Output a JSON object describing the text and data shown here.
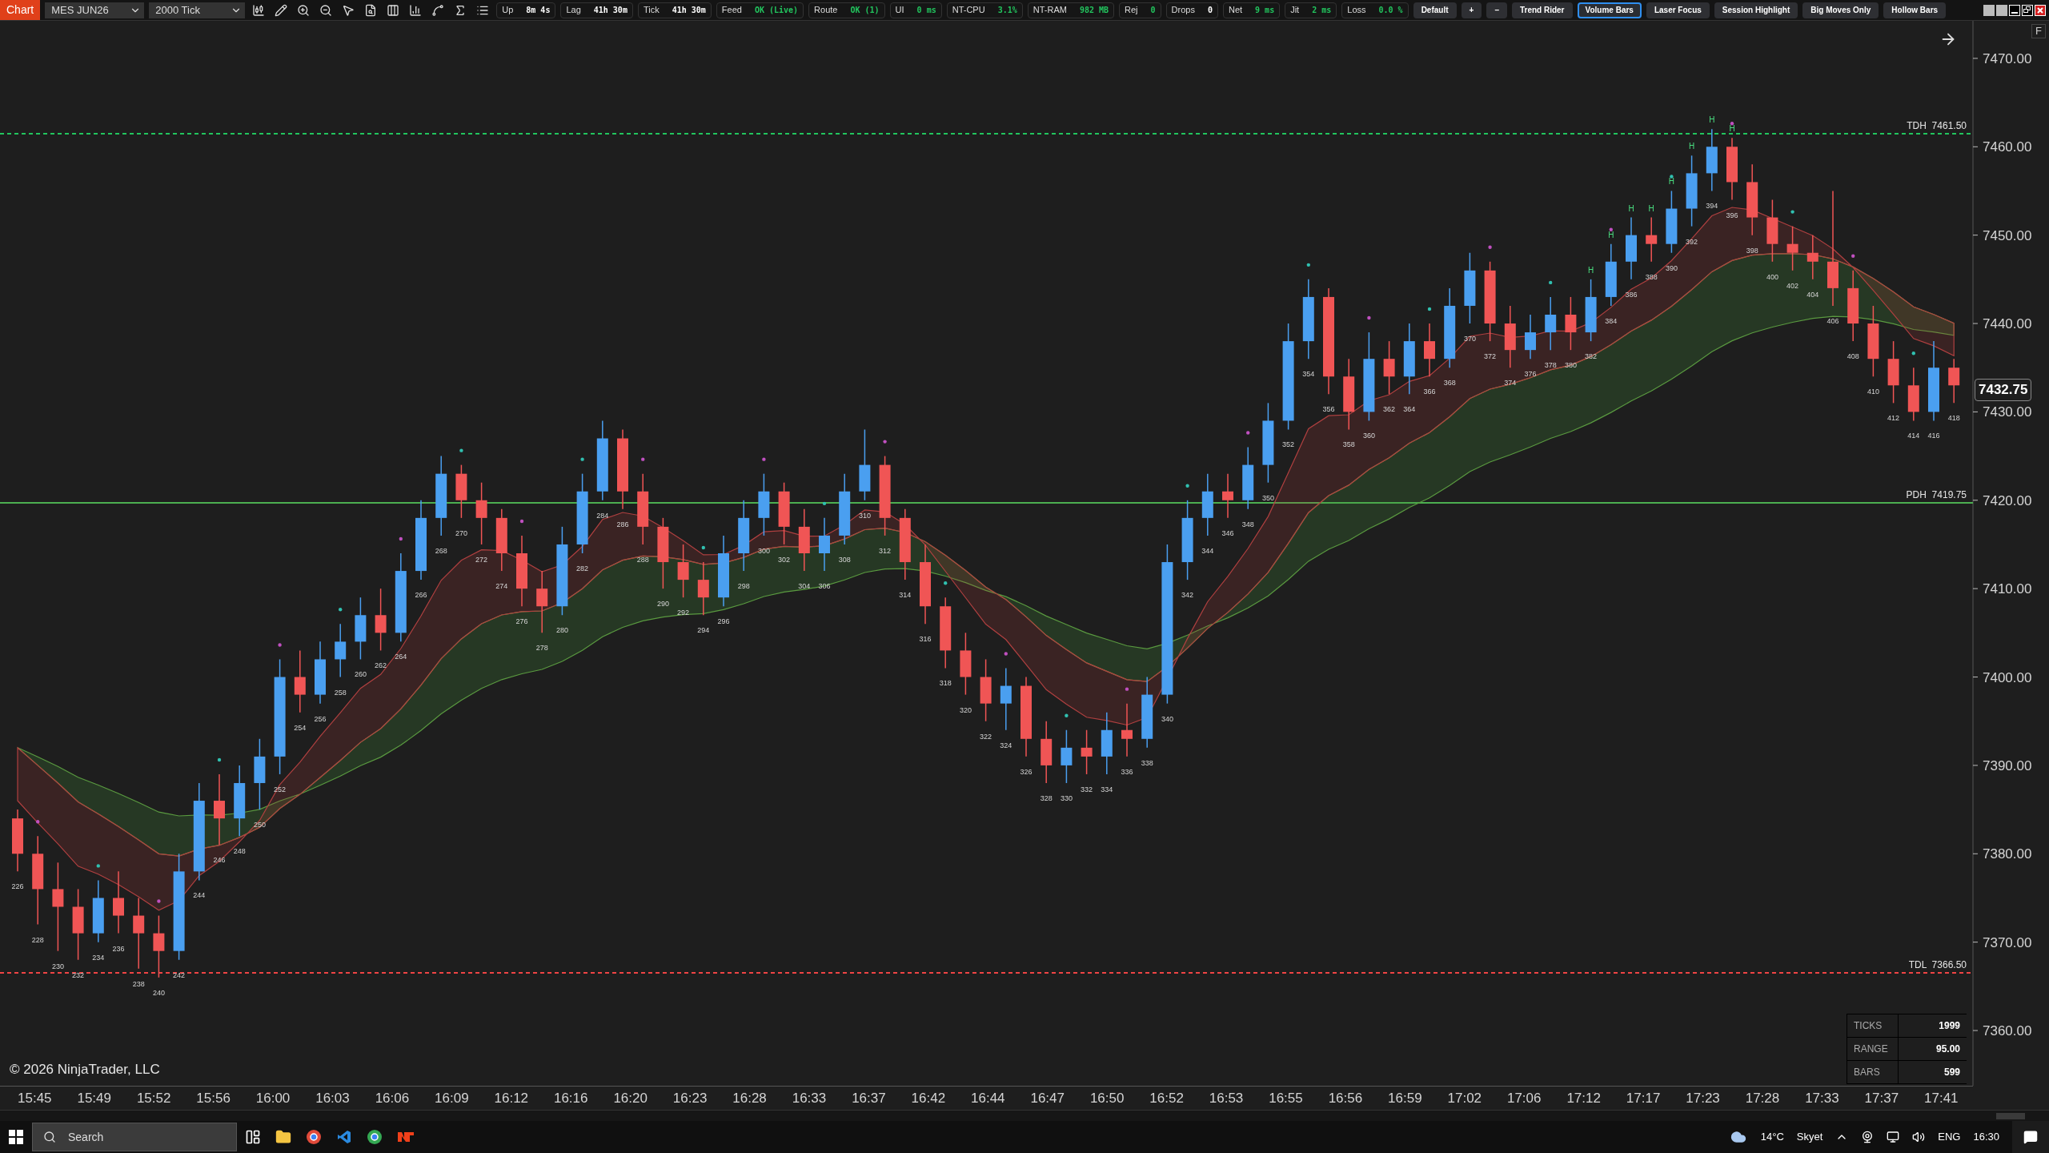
{
  "toolbar": {
    "title": "Chart",
    "instrument": "MES JUN26",
    "interval": "2000 Tick",
    "stats": [
      {
        "label": "Up",
        "value": "8m 4s",
        "color": "#ffffff"
      },
      {
        "label": "Lag",
        "value": "41h 30m",
        "color": "#ffffff"
      },
      {
        "label": "Tick",
        "value": "41h 30m",
        "color": "#ffffff"
      },
      {
        "label": "Feed",
        "value": "OK (Live)",
        "color": "#22c55e"
      },
      {
        "label": "Route",
        "value": "OK (1)",
        "color": "#22c55e"
      },
      {
        "label": "UI",
        "value": "0 ms",
        "color": "#22c55e"
      },
      {
        "label": "NT-CPU",
        "value": "3.1%",
        "color": "#22c55e"
      },
      {
        "label": "NT-RAM",
        "value": "982 MB",
        "color": "#22c55e"
      },
      {
        "label": "Rej",
        "value": "0",
        "color": "#22c55e"
      },
      {
        "label": "Drops",
        "value": "0",
        "color": "#ffffff"
      },
      {
        "label": "Net",
        "value": "9 ms",
        "color": "#22c55e"
      },
      {
        "label": "Jit",
        "value": "2 ms",
        "color": "#22c55e"
      },
      {
        "label": "Loss",
        "value": "0.0 %",
        "color": "#22c55e"
      }
    ],
    "buttons": [
      {
        "label": "Default",
        "selected": false
      },
      {
        "label": "+",
        "selected": false
      },
      {
        "label": "–",
        "selected": false
      },
      {
        "label": "Trend Rider",
        "selected": false
      },
      {
        "label": "Volume Bars",
        "selected": true
      },
      {
        "label": "Laser Focus",
        "selected": false
      },
      {
        "label": "Session Highlight",
        "selected": false
      },
      {
        "label": "Big Moves Only",
        "selected": false
      },
      {
        "label": "Hollow Bars",
        "selected": false
      }
    ]
  },
  "chart": {
    "corner_button": "F",
    "current_price": "7432.75",
    "levels": [
      {
        "label": "TDH  7461.50",
        "color": "#22c55e"
      },
      {
        "label": "PDH  7419.75",
        "color": "#4caf50"
      },
      {
        "label": "TDL  7366.50",
        "color": "#ef4444"
      }
    ],
    "swing_marks": [
      "H",
      "H",
      "H",
      "H",
      "H",
      "H",
      "H",
      "H"
    ],
    "copyright": "© 2026 NinjaTrader, LLC",
    "stats": [
      {
        "label": "TICKS",
        "value": "1999"
      },
      {
        "label": "RANGE",
        "value": "95.00"
      },
      {
        "label": "BARS",
        "value": "599"
      }
    ],
    "chart_data": {
      "type": "candlestick",
      "categories": [
        "226",
        "228",
        "230",
        "232",
        "234",
        "236",
        "238",
        "240",
        "242",
        "244",
        "246",
        "248",
        "250",
        "252",
        "254",
        "256",
        "258",
        "260",
        "262",
        "264",
        "266",
        "268",
        "270",
        "272",
        "274",
        "276",
        "278",
        "280",
        "282",
        "284",
        "286",
        "288",
        "290",
        "292",
        "294",
        "296",
        "298",
        "300",
        "302",
        "304",
        "306",
        "308",
        "310",
        "312",
        "314",
        "316",
        "318",
        "320",
        "322",
        "324",
        "326",
        "328",
        "330",
        "332",
        "334",
        "336",
        "338",
        "340",
        "342",
        "344",
        "346",
        "348",
        "350",
        "352",
        "354",
        "356",
        "358",
        "360",
        "362",
        "364",
        "366",
        "368",
        "370",
        "372",
        "374",
        "376",
        "378",
        "380",
        "382",
        "384",
        "386",
        "388",
        "390",
        "392",
        "394",
        "396",
        "398",
        "400",
        "402",
        "404",
        "406",
        "408",
        "410",
        "412",
        "414",
        "416",
        "418"
      ],
      "ylim": [
        7353.75,
        7474.25
      ],
      "yticks": [
        {
          "value": 7470,
          "label": "7470.00"
        },
        {
          "value": 7460,
          "label": "7460.00"
        },
        {
          "value": 7450,
          "label": "7450.00"
        },
        {
          "value": 7440,
          "label": "7440.00"
        },
        {
          "value": 7430,
          "label": "7430.00"
        },
        {
          "value": 7420,
          "label": "7420.00"
        },
        {
          "value": 7410,
          "label": "7410.00"
        },
        {
          "value": 7400,
          "label": "7400.00"
        },
        {
          "value": 7390,
          "label": "7390.00"
        },
        {
          "value": 7380,
          "label": "7380.00"
        },
        {
          "value": 7370,
          "label": "7370.00"
        },
        {
          "value": 7360,
          "label": "7360.00"
        }
      ],
      "ohlc": [
        [
          7384,
          7385,
          7378,
          7380
        ],
        [
          7380,
          7382,
          7372,
          7376
        ],
        [
          7376,
          7379,
          7369,
          7374
        ],
        [
          7374,
          7376,
          7368,
          7371
        ],
        [
          7371,
          7377,
          7370,
          7375
        ],
        [
          7375,
          7378,
          7371,
          7373
        ],
        [
          7373,
          7375,
          7367,
          7371
        ],
        [
          7371,
          7373,
          7366,
          7369
        ],
        [
          7369,
          7380,
          7368,
          7378
        ],
        [
          7378,
          7388,
          7377,
          7386
        ],
        [
          7386,
          7389,
          7381,
          7384
        ],
        [
          7384,
          7390,
          7382,
          7388
        ],
        [
          7388,
          7393,
          7385,
          7391
        ],
        [
          7391,
          7402,
          7389,
          7400
        ],
        [
          7400,
          7403,
          7396,
          7398
        ],
        [
          7398,
          7404,
          7397,
          7402
        ],
        [
          7402,
          7406,
          7400,
          7404
        ],
        [
          7404,
          7409,
          7402,
          7407
        ],
        [
          7407,
          7410,
          7403,
          7405
        ],
        [
          7405,
          7414,
          7404,
          7412
        ],
        [
          7412,
          7420,
          7411,
          7418
        ],
        [
          7418,
          7425,
          7416,
          7423
        ],
        [
          7423,
          7424,
          7418,
          7420
        ],
        [
          7420,
          7422,
          7415,
          7418
        ],
        [
          7418,
          7419,
          7412,
          7414
        ],
        [
          7414,
          7416,
          7408,
          7410
        ],
        [
          7410,
          7412,
          7405,
          7408
        ],
        [
          7408,
          7417,
          7407,
          7415
        ],
        [
          7415,
          7423,
          7414,
          7421
        ],
        [
          7421,
          7429,
          7420,
          7427
        ],
        [
          7427,
          7428,
          7419,
          7421
        ],
        [
          7421,
          7423,
          7415,
          7417
        ],
        [
          7417,
          7418,
          7410,
          7413
        ],
        [
          7413,
          7415,
          7409,
          7411
        ],
        [
          7411,
          7413,
          7407,
          7409
        ],
        [
          7409,
          7416,
          7408,
          7414
        ],
        [
          7414,
          7420,
          7412,
          7418
        ],
        [
          7418,
          7423,
          7416,
          7421
        ],
        [
          7421,
          7422,
          7415,
          7417
        ],
        [
          7417,
          7419,
          7412,
          7414
        ],
        [
          7414,
          7418,
          7412,
          7416
        ],
        [
          7416,
          7423,
          7415,
          7421
        ],
        [
          7421,
          7428,
          7420,
          7424
        ],
        [
          7424,
          7425,
          7416,
          7418
        ],
        [
          7418,
          7419,
          7411,
          7413
        ],
        [
          7413,
          7415,
          7406,
          7408
        ],
        [
          7408,
          7409,
          7401,
          7403
        ],
        [
          7403,
          7405,
          7398,
          7400
        ],
        [
          7400,
          7402,
          7395,
          7397
        ],
        [
          7397,
          7401,
          7394,
          7399
        ],
        [
          7399,
          7400,
          7391,
          7393
        ],
        [
          7393,
          7395,
          7388,
          7390
        ],
        [
          7390,
          7394,
          7388,
          7392
        ],
        [
          7392,
          7394,
          7389,
          7391
        ],
        [
          7391,
          7396,
          7389,
          7394
        ],
        [
          7394,
          7397,
          7391,
          7393
        ],
        [
          7393,
          7400,
          7392,
          7398
        ],
        [
          7398,
          7415,
          7397,
          7413
        ],
        [
          7413,
          7420,
          7411,
          7418
        ],
        [
          7418,
          7423,
          7416,
          7421
        ],
        [
          7421,
          7423,
          7418,
          7420
        ],
        [
          7420,
          7426,
          7419,
          7424
        ],
        [
          7424,
          7431,
          7422,
          7429
        ],
        [
          7429,
          7440,
          7428,
          7438
        ],
        [
          7438,
          7445,
          7436,
          7443
        ],
        [
          7443,
          7444,
          7432,
          7434
        ],
        [
          7434,
          7436,
          7428,
          7430
        ],
        [
          7430,
          7439,
          7429,
          7436
        ],
        [
          7436,
          7438,
          7432,
          7434
        ],
        [
          7434,
          7440,
          7432,
          7438
        ],
        [
          7438,
          7440,
          7434,
          7436
        ],
        [
          7436,
          7444,
          7435,
          7442
        ],
        [
          7442,
          7448,
          7440,
          7446
        ],
        [
          7446,
          7447,
          7438,
          7440
        ],
        [
          7440,
          7442,
          7435,
          7437
        ],
        [
          7437,
          7441,
          7436,
          7439
        ],
        [
          7439,
          7443,
          7437,
          7441
        ],
        [
          7441,
          7443,
          7437,
          7439
        ],
        [
          7439,
          7445,
          7438,
          7443
        ],
        [
          7443,
          7449,
          7442,
          7447
        ],
        [
          7447,
          7452,
          7445,
          7450
        ],
        [
          7450,
          7452,
          7447,
          7449
        ],
        [
          7449,
          7455,
          7448,
          7453
        ],
        [
          7453,
          7459,
          7451,
          7457
        ],
        [
          7457,
          7462,
          7455,
          7460
        ],
        [
          7460,
          7461,
          7454,
          7456
        ],
        [
          7456,
          7458,
          7450,
          7452
        ],
        [
          7452,
          7454,
          7447,
          7449
        ],
        [
          7449,
          7451,
          7446,
          7448
        ],
        [
          7448,
          7450,
          7445,
          7447
        ],
        [
          7447,
          7455,
          7442,
          7444
        ],
        [
          7444,
          7446,
          7438,
          7440
        ],
        [
          7440,
          7442,
          7434,
          7436
        ],
        [
          7436,
          7438,
          7431,
          7433
        ],
        [
          7433,
          7435,
          7429,
          7430
        ],
        [
          7430,
          7438,
          7429,
          7435
        ],
        [
          7435,
          7436,
          7431,
          7433
        ]
      ]
    }
  },
  "time_axis": [
    "15:45",
    "15:49",
    "15:52",
    "15:56",
    "16:00",
    "16:03",
    "16:06",
    "16:09",
    "16:12",
    "16:16",
    "16:20",
    "16:23",
    "16:28",
    "16:33",
    "16:37",
    "16:42",
    "16:44",
    "16:47",
    "16:50",
    "16:52",
    "16:53",
    "16:55",
    "16:56",
    "16:59",
    "17:02",
    "17:06",
    "17:12",
    "17:17",
    "17:23",
    "17:28",
    "17:33",
    "17:37",
    "17:41"
  ],
  "taskbar": {
    "placeholder": "Search",
    "temperature": "14°C",
    "weather": "Skyet",
    "language": "ENG",
    "time": "16:30"
  }
}
